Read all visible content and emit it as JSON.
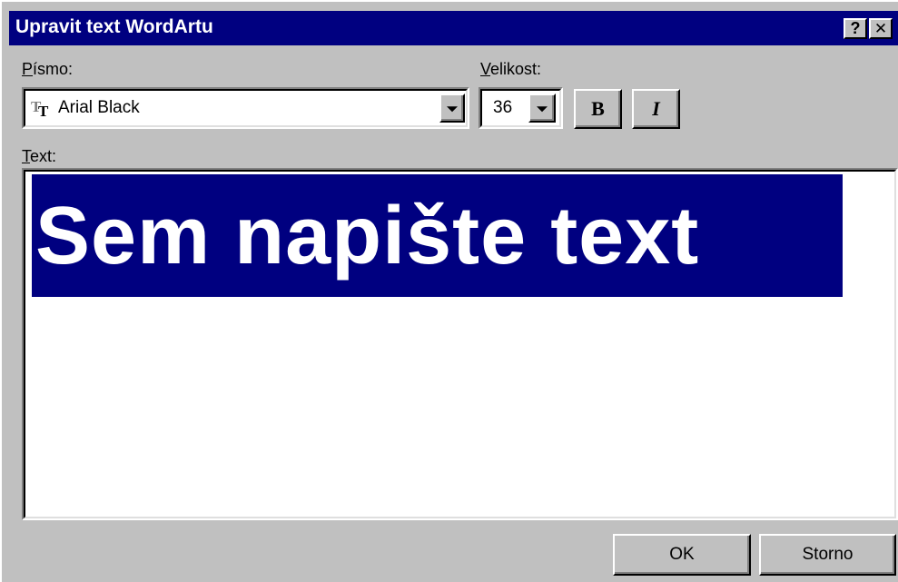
{
  "window": {
    "title": "Upravit text WordArtu",
    "help_label": "?",
    "close_label": "✕"
  },
  "font": {
    "label": "Písmo:",
    "value": "Arial Black",
    "icon": "truetype-font-icon"
  },
  "size": {
    "label": "Velikost:",
    "value": "36"
  },
  "format": {
    "bold_label": "B",
    "italic_label": "I"
  },
  "text": {
    "label": "Text:",
    "value": "Sem napište text"
  },
  "buttons": {
    "ok_label": "OK",
    "cancel_label": "Storno"
  },
  "colors": {
    "title_bar": "#000080",
    "selection": "#000080",
    "face": "#c0c0c0"
  }
}
